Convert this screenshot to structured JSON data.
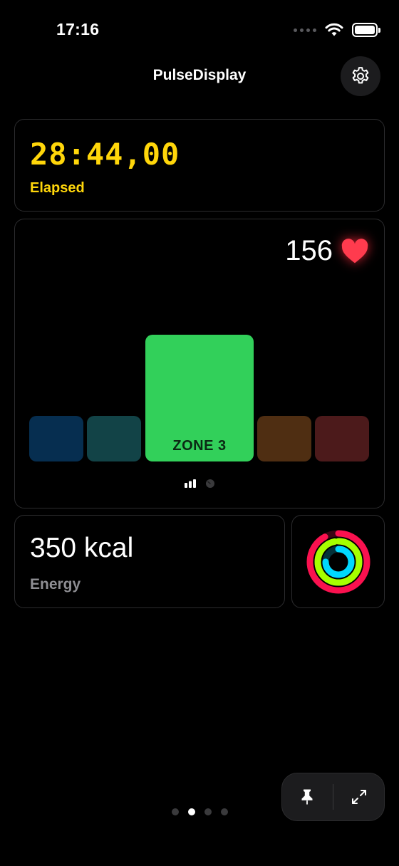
{
  "status_bar": {
    "time": "17:16",
    "icons": [
      "signal-dots",
      "wifi-icon",
      "battery-icon"
    ]
  },
  "nav": {
    "title": "PulseDisplay",
    "settings_icon": "gear-icon"
  },
  "elapsed": {
    "value": "28:44,00",
    "label": "Elapsed",
    "color": "#ffd60a"
  },
  "heart_rate": {
    "value": "156",
    "icon": "heart-icon",
    "icon_color": "#ff3b4e",
    "zones": [
      {
        "name": "zone-1",
        "label": "",
        "color": "#062e50",
        "active": false
      },
      {
        "name": "zone-2",
        "label": "",
        "color": "#124347",
        "active": false
      },
      {
        "name": "zone-3",
        "label": "ZONE 3",
        "color": "#32d05a",
        "active": true
      },
      {
        "name": "zone-4",
        "label": "",
        "color": "#4f2e12",
        "active": false
      },
      {
        "name": "zone-5",
        "label": "",
        "color": "#4c1a1b",
        "active": false
      }
    ],
    "view_toggle": [
      "bar-chart-icon",
      "gauge-icon"
    ]
  },
  "energy": {
    "value": "350 kcal",
    "label": "Energy",
    "label_color": "#8e8e93"
  },
  "activity_rings": {
    "icon": "activity-rings-icon",
    "colors": {
      "move": "#fa114f",
      "exercise": "#a6ff00",
      "stand": "#00d8ff"
    },
    "progress": {
      "move": 0.92,
      "exercise": 0.97,
      "stand": 0.75
    }
  },
  "pagination": {
    "count": 4,
    "active_index": 1
  },
  "action_bar": {
    "icons": [
      "pin-icon",
      "expand-icon"
    ]
  }
}
